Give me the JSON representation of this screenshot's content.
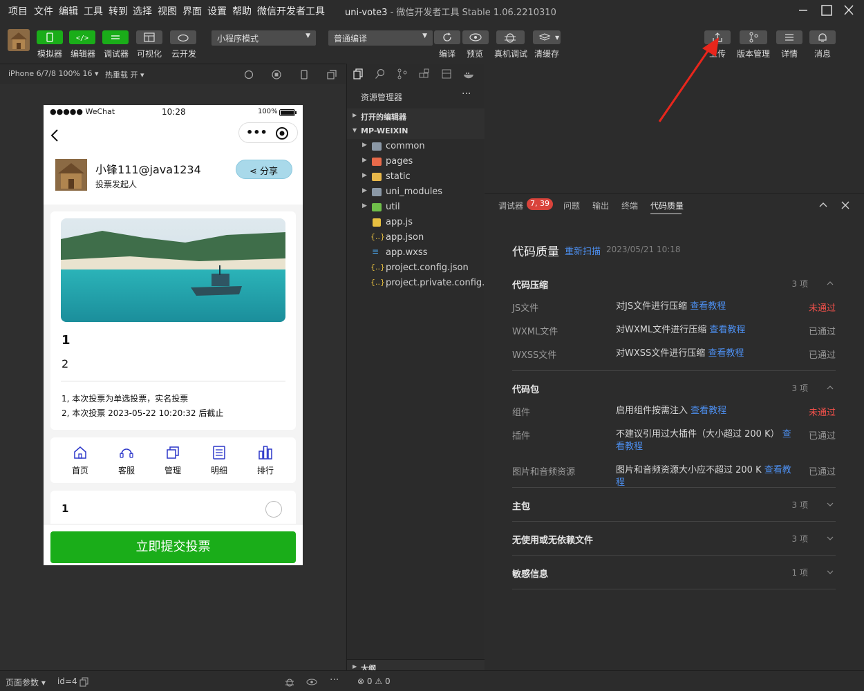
{
  "menu": [
    "项目",
    "文件",
    "编辑",
    "工具",
    "转到",
    "选择",
    "视图",
    "界面",
    "设置",
    "帮助",
    "微信开发者工具"
  ],
  "window": {
    "title": "uni-vote3",
    "subtitle": "- 微信开发者工具 Stable 1.06.2210310"
  },
  "toolbar": {
    "left_buttons": [
      "模拟器",
      "编辑器",
      "调试器",
      "可视化",
      "云开发"
    ],
    "mode_select": "小程序模式",
    "compile_select": "普通编译",
    "center_buttons": [
      "编译",
      "预览",
      "真机调试",
      "清缓存"
    ],
    "right_buttons": [
      "上传",
      "版本管理",
      "详情",
      "消息"
    ]
  },
  "simbar": {
    "device": "iPhone 6/7/8 100% 16",
    "hotreload": "热重载 开"
  },
  "phone": {
    "status": {
      "carrier": "●●●●● WeChat",
      "time": "10:28",
      "battery": "100%"
    },
    "user": {
      "name": "小锋111@java1234",
      "role": "投票发起人",
      "share": "分享"
    },
    "vote": {
      "title": "1",
      "desc": "2",
      "note1": "1, 本次投票为单选投票，实名投票",
      "note2": "2, 本次投票 2023-05-22 10:20:32 后截止"
    },
    "nav": [
      "首页",
      "客服",
      "管理",
      "明细",
      "排行"
    ],
    "option1": "1",
    "submit": "立即提交投票"
  },
  "explorer": {
    "title": "资源管理器",
    "open_editors": "打开的编辑器",
    "root": "MP-WEIXIN",
    "folders": [
      "common",
      "pages",
      "static",
      "uni_modules",
      "util"
    ],
    "files": [
      "app.js",
      "app.json",
      "app.wxss",
      "project.config.json",
      "project.private.config.js..."
    ],
    "outline": "大纲"
  },
  "devtools": {
    "tabs": [
      "调试器",
      "问题",
      "输出",
      "终端",
      "代码质量"
    ],
    "badge": "7, 39",
    "heading": "代码质量",
    "rescan": "重新扫描",
    "date": "2023/05/21 10:18",
    "sections": [
      {
        "name": "代码压缩",
        "count": "3 项",
        "rows": [
          {
            "k": "JS文件",
            "d": "对JS文件进行压缩",
            "link": "查看教程",
            "s": "未通过"
          },
          {
            "k": "WXML文件",
            "d": "对WXML文件进行压缩",
            "link": "查看教程",
            "s": "已通过"
          },
          {
            "k": "WXSS文件",
            "d": "对WXSS文件进行压缩",
            "link": "查看教程",
            "s": "已通过"
          }
        ]
      },
      {
        "name": "代码包",
        "count": "3 项",
        "rows": [
          {
            "k": "组件",
            "d": "启用组件按需注入",
            "link": "查看教程",
            "s": "未通过"
          },
          {
            "k": "插件",
            "d": "不建议引用过大插件（大小超过 200 K）",
            "link": "查看教程",
            "s": "已通过"
          },
          {
            "k": "图片和音频资源",
            "d": "图片和音频资源大小应不超过 200 K",
            "link": "查看教程",
            "s": "已通过"
          }
        ]
      },
      {
        "name": "主包",
        "count": "3 项"
      },
      {
        "name": "无使用或无依赖文件",
        "count": "3 项"
      },
      {
        "name": "敏感信息",
        "count": "1 项"
      }
    ]
  },
  "statusbar": {
    "page_params": "页面参数",
    "page_id": "id=4",
    "errors": "0",
    "warnings": "0"
  }
}
